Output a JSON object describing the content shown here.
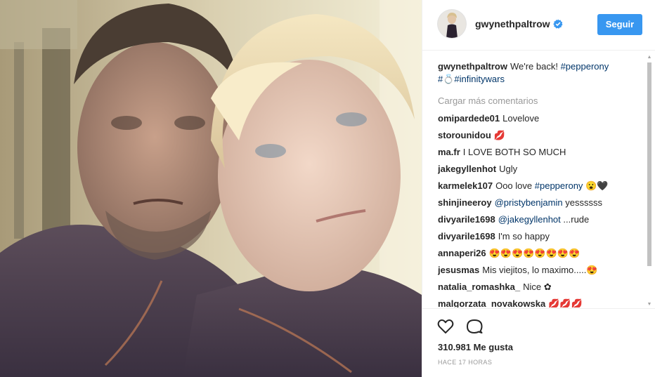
{
  "post": {
    "owner_username": "gwynethpaltrow",
    "follow_label": "Seguir",
    "caption": {
      "username": "gwynethpaltrow",
      "text": "We're back!",
      "hashtag1": "#pepperony",
      "hashtag2": "#💍#infinitywars"
    },
    "load_more": "Cargar más comentarios",
    "comments": [
      {
        "user": "omipardede01",
        "text": "Lovelove"
      },
      {
        "user": "storounidou",
        "text": "💋"
      },
      {
        "user": "ma.fr",
        "text": "I LOVE BOTH SO MUCH"
      },
      {
        "user": "jakegyllenhot",
        "text": "Ugly"
      },
      {
        "user": "karmelek107",
        "text": "Ooo love",
        "tag": "#pepperony",
        "after": "😮🖤"
      },
      {
        "user": "shinjineeroy",
        "tag": "@pristybenjamin",
        "after": "yessssss"
      },
      {
        "user": "divyarile1698",
        "tag": "@jakegyllenhot",
        "after": "...rude"
      },
      {
        "user": "divyarile1698",
        "text": "I'm so happy"
      },
      {
        "user": "annaperi26",
        "text": "😍😍😍😍😍😍😍😍"
      },
      {
        "user": "jesusmas",
        "text": "Mis viejitos, lo maximo.....😍"
      },
      {
        "user": "natalia_romashka_",
        "text": "Nice ✿"
      },
      {
        "user": "malgorzata_novakowska",
        "text": "💋💋💋"
      }
    ],
    "likes": "310.981 Me gusta",
    "timestamp": "HACE 17 HORAS",
    "icons": {
      "like": "heart-icon",
      "comment": "comment-icon",
      "verified": "verified-badge-icon"
    },
    "colors": {
      "accent": "#3897f0",
      "hashtag": "#003569",
      "text": "#262626",
      "muted": "#999999"
    }
  }
}
